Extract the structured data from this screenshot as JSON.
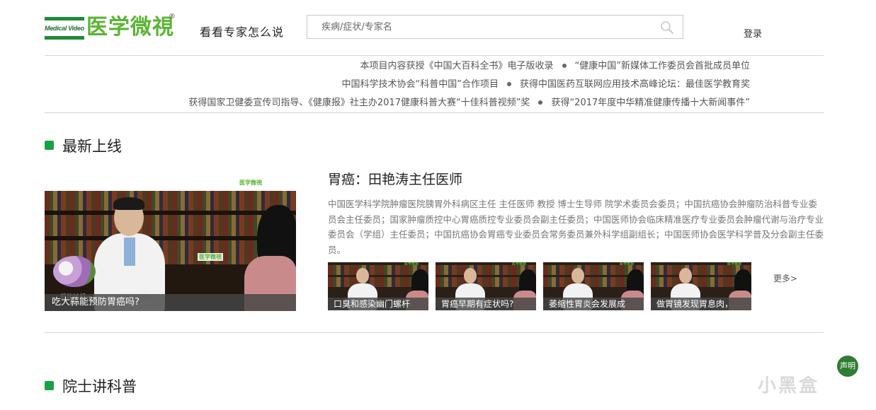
{
  "header": {
    "logo_en": "Medical Video",
    "logo_cn": "医学微視",
    "logo_reg": "®",
    "slogan": "看看专家怎么说",
    "search_placeholder": "疾病/症状/专家名",
    "login_label": "登录"
  },
  "awards": {
    "line1_a": "本项目内容获授《中国大百科全书》电子版收录",
    "line1_b": "“健康中国”新媒体工作委员会首批成员单位",
    "line2_a": "中国科学技术协会“科普中国”合作项目",
    "line2_b": "获得中国医药互联网应用技术高峰论坛：最佳医学教育奖",
    "line3_a": "获得国家卫健委宣传司指导、《健康报》社主办2017健康科普大赛“十佳科普视频”奖",
    "line3_b": "获得“2017年度中华精准健康传播十大新闻事件”"
  },
  "latest": {
    "section_title": "最新上线",
    "feature_caption": "吃大蒜能预防胃癌吗?",
    "feature_subcaption": "蒜能够起一定的治疗和预防作用",
    "topic_title": "胃癌：田艳涛主任医师",
    "topic_desc": "中国医学科学院肿瘤医院胰胃外科病区主任 主任医师 教授 博士生导师 院学术委员会委员；中国抗癌协会肿瘤防治科普专业委员会主任委员；国家肿瘤质控中心胃癌质控专业委员会副主任委员；中国医师协会临床精准医疗专业委员会肿瘤代谢与治疗专业委员会（学组）主任委员；中国抗癌协会胃癌专业委员会常务委员兼外科学组副组长；中国医师协会医学科学普及分会副主任委员。",
    "thumbs": [
      {
        "caption": "口臭和感染幽门螺杆"
      },
      {
        "caption": "胃癌早期有症状吗?"
      },
      {
        "caption": "萎缩性胃炎会发展成"
      },
      {
        "caption": "做胃镜发现胃息肉，"
      }
    ],
    "more_label": "更多>"
  },
  "academician": {
    "section_title": "院士讲科普"
  },
  "float": {
    "notice_label": "声明",
    "watermark": "小黑盒"
  },
  "colors": {
    "brand_green": "#5ab533",
    "section_marker": "#18a04a",
    "badge_green": "#2e7d32"
  }
}
